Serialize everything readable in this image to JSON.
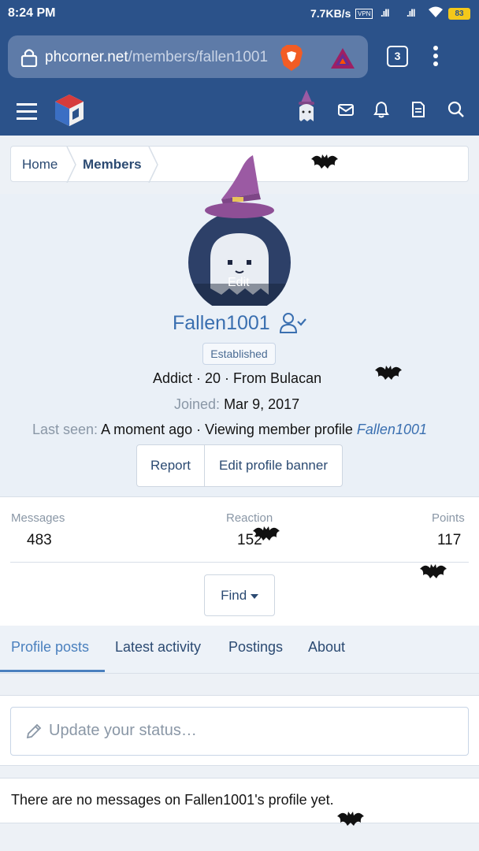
{
  "status_bar": {
    "time": "8:24 PM",
    "net_speed": "7.7KB/s",
    "vpn": "VPN",
    "signal_1": ".ıll",
    "signal_2": ".ıll",
    "battery": "83"
  },
  "browser": {
    "url_host": "phcorner.net",
    "url_path": "/members/fallen1001",
    "tab_count": "3"
  },
  "breadcrumb": {
    "home": "Home",
    "members": "Members"
  },
  "profile": {
    "avatar_edit": "Edit",
    "username": "Fallen1001",
    "badge": "Established",
    "info_line": "Addict · 20 · From Bulacan",
    "joined_label": "Joined:",
    "joined_value": "Mar 9, 2017",
    "last_seen_label": "Last seen:",
    "last_seen_value": "A moment ago · Viewing member profile",
    "last_seen_link": "Fallen1001",
    "report_label": "Report",
    "banner_label": "Edit profile banner"
  },
  "stats": {
    "messages_label": "Messages",
    "messages_value": "483",
    "reaction_label": "Reaction",
    "reaction_value": "152",
    "points_label": "Points",
    "points_value": "117",
    "find_label": "Find"
  },
  "tabs": {
    "profile_posts": "Profile posts",
    "latest_activity": "Latest activity",
    "postings": "Postings",
    "about": "About"
  },
  "status_update": {
    "placeholder": "Update your status…"
  },
  "empty_message": "There are no messages on Fallen1001's profile yet.",
  "colors": {
    "header_blue": "#2b528a",
    "link_blue": "#3a6fb0",
    "page_bg": "#edf1f6"
  }
}
